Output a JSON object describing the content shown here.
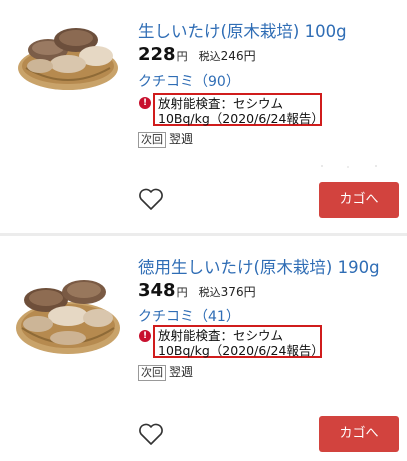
{
  "products": [
    {
      "name": "生しいたけ(原木栽培) 100g",
      "price": "228",
      "price_unit": "円",
      "tax_label": "税込",
      "tax_price": "246円",
      "reviews": "クチコミ（90）",
      "alert_icon": "exclamation-icon",
      "radiation_line1": "放射能検査：セシウム",
      "radiation_line2": "10Bq/kg（2020/6/24報告）",
      "delivery_badge": "次回",
      "delivery_value": "翌週",
      "favorite_icon": "heart-outline-icon",
      "cart_label": "カゴへ"
    },
    {
      "name": "徳用生しいたけ(原木栽培) 190g",
      "price": "348",
      "price_unit": "円",
      "tax_label": "税込",
      "tax_price": "376円",
      "reviews": "クチコミ（41）",
      "alert_icon": "exclamation-icon",
      "radiation_line1": "放射能検査：セシウム",
      "radiation_line2": "10Bq/kg（2020/6/24報告）",
      "delivery_badge": "次回",
      "delivery_value": "翌週",
      "favorite_icon": "heart-outline-icon",
      "cart_label": "カゴへ"
    }
  ],
  "colors": {
    "link": "#2f6db5",
    "cart_button": "#d2433e",
    "alert_border": "#d01c1c",
    "alert_icon": "#c8102e",
    "separator": "#ececec"
  }
}
